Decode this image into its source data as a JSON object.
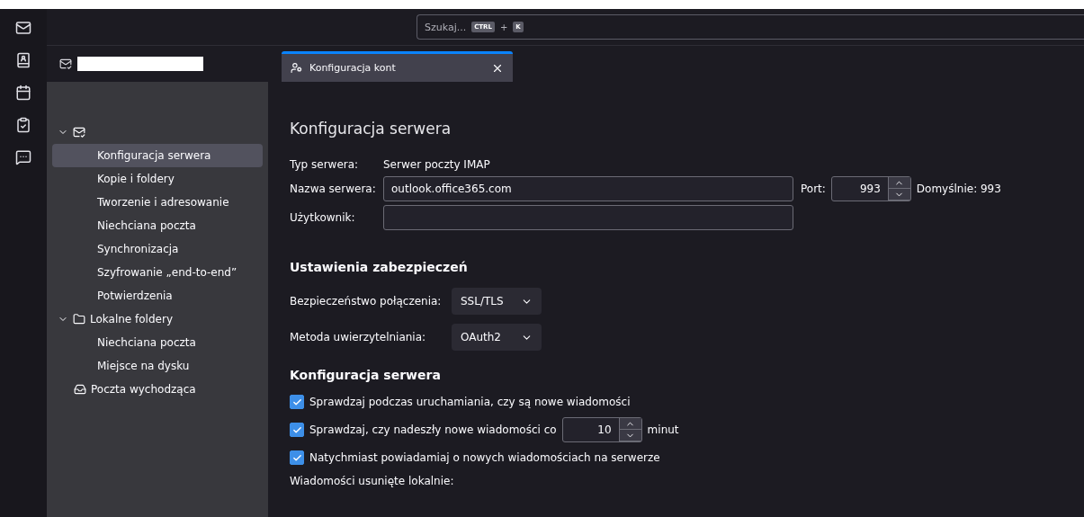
{
  "search": {
    "placeholder": "Szukaj...",
    "shortcut_keys": [
      "CTRL",
      "K"
    ],
    "shortcut_joiner": "+"
  },
  "account_header": {
    "redacted": true
  },
  "tabs": [
    {
      "label": "Konfiguracja kont",
      "selected": true
    }
  ],
  "sidebar": {
    "tree": [
      {
        "kind": "account",
        "expanded": true,
        "children": [
          {
            "label": "Konfiguracja serwera",
            "selected": true
          },
          {
            "label": "Kopie i foldery",
            "selected": false
          },
          {
            "label": "Tworzenie i adresowanie",
            "selected": false
          },
          {
            "label": "Niechciana poczta",
            "selected": false
          },
          {
            "label": "Synchronizacja",
            "selected": false
          },
          {
            "label": "Szyfrowanie „end-to-end”",
            "selected": false
          },
          {
            "label": "Potwierdzenia",
            "selected": false
          }
        ]
      },
      {
        "kind": "folder",
        "label": "Lokalne foldery",
        "expanded": true,
        "children": [
          {
            "label": "Niechciana poczta",
            "selected": false
          },
          {
            "label": "Miejsce na dysku",
            "selected": false
          }
        ]
      },
      {
        "kind": "outbox",
        "label": "Poczta wychodząca"
      }
    ]
  },
  "page": {
    "title": "Konfiguracja serwera",
    "server_type": {
      "label": "Typ serwera:",
      "value": "Serwer poczty IMAP"
    },
    "server_name": {
      "label": "Nazwa serwera:",
      "value": "outlook.office365.com"
    },
    "port": {
      "label": "Port:",
      "value": "993",
      "default": "Domyślnie: 993"
    },
    "user": {
      "label": "Użytkownik:"
    },
    "security": {
      "title": "Ustawienia zabezpieczeń",
      "selects": [
        {
          "label": "Bezpieczeństwo połączenia:",
          "value": "SSL/TLS"
        },
        {
          "label": "Metoda uwierzytelniania:",
          "value": "OAuth2"
        }
      ]
    },
    "server_settings": {
      "title": "Konfiguracja serwera",
      "options": [
        {
          "kind": "check",
          "label": "Sprawdzaj podczas uruchamiania, czy są nowe wiadomości",
          "checked": true
        },
        {
          "kind": "interval",
          "label": "Sprawdzaj, czy nadeszły nowe wiadomości co",
          "value": "10",
          "unit": "minut",
          "checked": true
        },
        {
          "kind": "check",
          "label": "Natychmiast powiadamiaj o nowych wiadomościach na serwerze",
          "checked": true
        }
      ]
    },
    "next_section": "Wiadomości usunięte lokalnie:"
  }
}
